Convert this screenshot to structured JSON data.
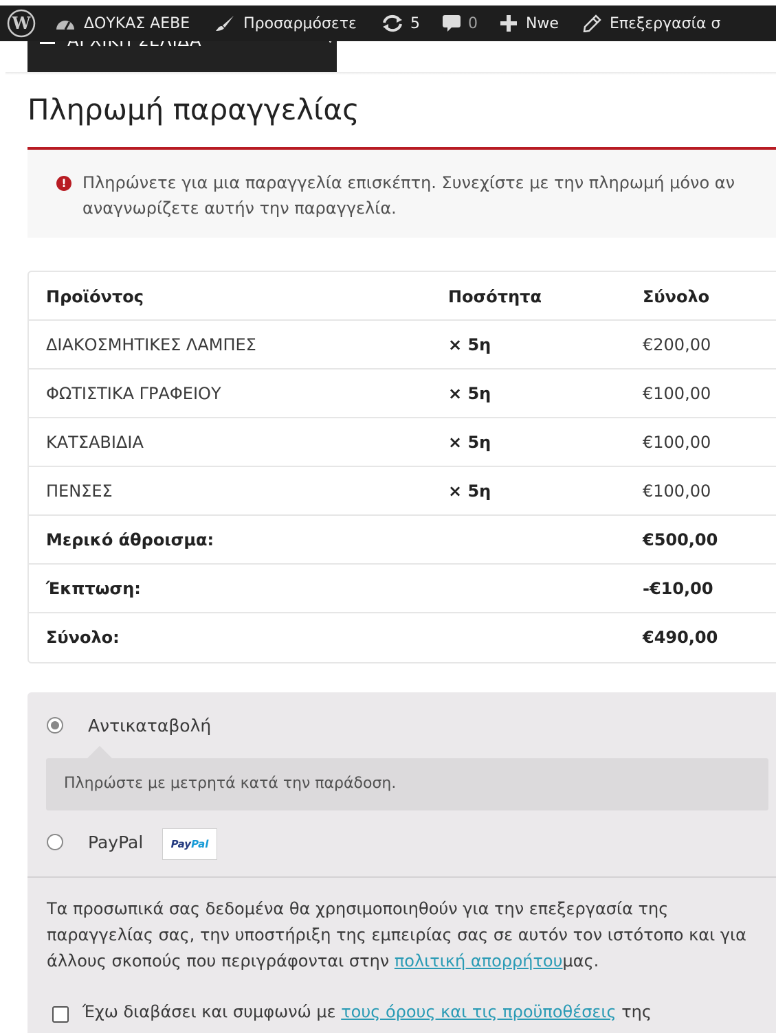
{
  "admin_bar": {
    "site_name": "ΔΟΥΚΑΣ ΑΕΒΕ",
    "customize": "Προσαρμόσετε",
    "updates_count": "5",
    "comments_count": "0",
    "new": "Nwe",
    "edit": "Επεξεργασία σ"
  },
  "menu": {
    "label": "ΑΡΧΙΚΗ ΣΕΛΙΔΑ"
  },
  "page": {
    "title": "Πληρωμή παραγγελίας"
  },
  "notice": {
    "message": "Πληρώνετε για μια παραγγελία επισκέπτη. Συνεχίστε με την πληρωμή μόνο αν αναγνωρίζετε αυτήν την παραγγελία."
  },
  "order_table": {
    "headers": [
      "Προϊόντος",
      "Ποσότητα",
      "Σύνολο"
    ],
    "items": [
      {
        "product": "ΔΙΑΚΟΣΜΗΤΙΚΕΣ ΛΑΜΠΕΣ",
        "qty": "× 5η",
        "total": "€200,00"
      },
      {
        "product": "ΦΩΤΙΣΤΙΚΑ ΓΡΑΦΕΙΟΥ",
        "qty": "× 5η",
        "total": "€100,00"
      },
      {
        "product": "ΚΑΤΣΑΒΙΔΙΑ",
        "qty": "× 5η",
        "total": "€100,00"
      },
      {
        "product": "ΠΕΝΣΕΣ",
        "qty": "× 5η",
        "total": "€100,00"
      }
    ],
    "subtotal_label": "Μερικό άθροισμα:",
    "subtotal_value": "€500,00",
    "discount_label": "Έκπτωση:",
    "discount_value": "-€10,00",
    "total_label": "Σύνολο:",
    "total_value": "€490,00"
  },
  "payment": {
    "cod_label": "Αντικαταβολή",
    "cod_description": "Πληρώστε με μετρητά κατά την παράδοση.",
    "paypal_label": "PayPal",
    "paypal_logo_a": "Pay",
    "paypal_logo_b": "Pal",
    "selected": "cod",
    "privacy_text_before": "Τα προσωπικά σας δεδομένα θα χρησιμοποιηθούν για την επεξεργασία της παραγγελίας σας, την υποστήριξη της εμπειρίας σας σε αυτόν τον ιστότοπο και για άλλους σκοπούς που περιγράφονται στην ",
    "privacy_link": "πολιτική απορρήτου",
    "privacy_text_after": "μας.",
    "terms_before": "Έχω διαβάσει και συμφωνώ με ",
    "terms_link": "τους όρους και τις προϋποθέσεις",
    "terms_after": " της"
  },
  "colors": {
    "admin_bar": "#1e1e1e",
    "notice_border": "#b81c23",
    "link": "#2a9bb5",
    "payment_bg": "#ebe9eb"
  }
}
